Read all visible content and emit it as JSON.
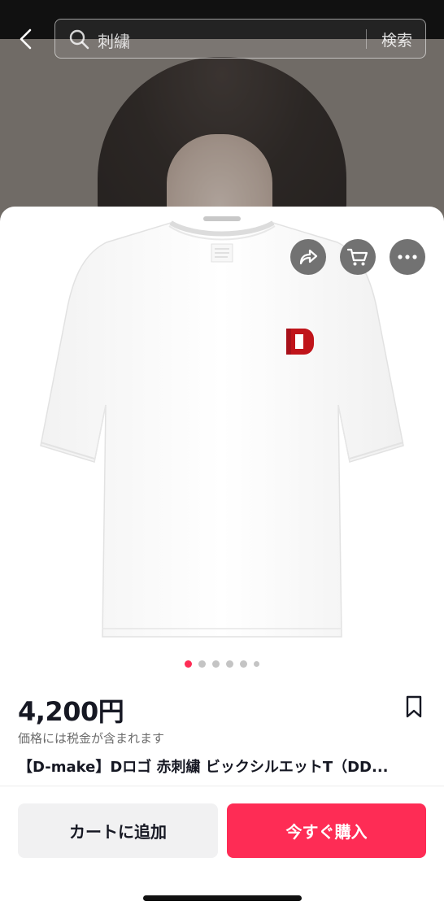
{
  "search": {
    "query": "刺繍",
    "button_label": "検索"
  },
  "product": {
    "price": "4,200円",
    "tax_note": "価格には税金が含まれます",
    "title": "【D-make】Dロゴ 赤刺繍 ビックシルエットT（DD...",
    "image_page": {
      "current": 1,
      "total": 6
    }
  },
  "actions": {
    "add_to_cart": "カートに追加",
    "buy_now": "今すぐ購入"
  },
  "icons": [
    "back-arrow-icon",
    "search-icon",
    "share-icon",
    "cart-icon",
    "more-icon",
    "bookmark-icon"
  ],
  "colors": {
    "accent": "#fe2c55",
    "logo_red": "#c0141a"
  }
}
